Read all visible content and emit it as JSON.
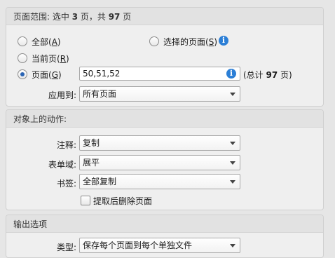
{
  "page_range": {
    "title_prefix": "页面范围: 选中 ",
    "selected_count": "3",
    "title_middle": " 页，共 ",
    "total_count": "97",
    "title_suffix": " 页",
    "all": {
      "text": "全部(",
      "key": "A",
      "close": ")"
    },
    "current": {
      "text": "当前页(",
      "key": "R",
      "close": ")"
    },
    "pages": {
      "text": "页面(",
      "key": "G",
      "close": ")"
    },
    "selected_pages": {
      "text": "选择的页面(",
      "key": "S",
      "close": ")"
    },
    "pages_value": "50,51,52",
    "total_prefix": "(总计 ",
    "total_number": "97",
    "total_suffix": " 页)",
    "apply_to_label": "应用到:",
    "apply_to_value": "所有页面"
  },
  "object_actions": {
    "title": "对象上的动作:",
    "annotations_label": "注释:",
    "annotations_value": "复制",
    "form_fields_label": "表单域:",
    "form_fields_value": "展平",
    "bookmarks_label": "书签:",
    "bookmarks_value": "全部复制",
    "extract_delete_label": "提取后删除页面"
  },
  "output": {
    "title": "输出选项",
    "type_label": "类型:",
    "type_value": "保存每个页面到每个单独文件"
  },
  "colors": {
    "accent": "#2a64b4",
    "info": "#2c7fd6"
  }
}
